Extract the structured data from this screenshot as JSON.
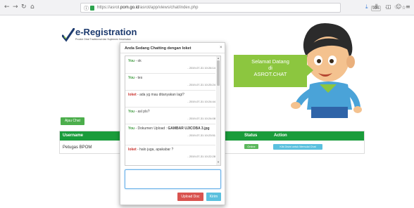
{
  "browser": {
    "url_prefix": "https://asrot.",
    "url_domain": "pom.go.id",
    "url_path": "/asrot/app/views/chat/index.php",
    "zoom": "90%",
    "info_icon": "info-icon",
    "lock_icon": "lock-icon"
  },
  "header": {
    "title": "e-Registration",
    "subtitle": "Produk Obat Tradisional dan Suplemen Kesehatan"
  },
  "welcome": {
    "line1": "Selamat Datang",
    "line2": "di",
    "line3": "ASROT.CHAT",
    "color": "#8cc63f"
  },
  "page": {
    "chat_button": "Ajuu Chat",
    "table": {
      "headers": [
        "Username",
        "Status",
        "Action"
      ],
      "rows": [
        {
          "username": "Petugas BPOM",
          "status": "Online",
          "action": "Klik Disini untuk Memulai Chat"
        }
      ]
    },
    "accent": "#1a9c3b"
  },
  "chat": {
    "title": "Anda Sedang Chatting dengan loket",
    "close": "×",
    "messages": [
      {
        "sender": "You",
        "sep": " - ",
        "text": "ok",
        "time": "- 2019-07-31 10:26:14"
      },
      {
        "sender": "You",
        "sep": " - ",
        "text": "tes",
        "time": "- 2019-07-31 10:25:24"
      },
      {
        "sender": "loket",
        "sep": " - ",
        "text": "ada yg mau ditanyakan lagi?",
        "time": "- 2019-07-31 10:24:44"
      },
      {
        "sender": "You",
        "sep": " - ",
        "text": "asl pls?",
        "time": "- 2019-07-31 10:24:08"
      },
      {
        "sender": "You",
        "sep": " - ",
        "text": "Dokumen Upload : ",
        "link": "GAMBAR UJICOBA 3.jpg",
        "time": "- 2019-07-31 10:23:51"
      },
      {
        "sender": "loket",
        "sep": " - ",
        "text": "halo juga, apakabar ?",
        "time": "- 2019-07-31 10:22:28"
      }
    ],
    "input_value": "",
    "upload_label": "Upload Doc",
    "send_label": "Kirim"
  }
}
